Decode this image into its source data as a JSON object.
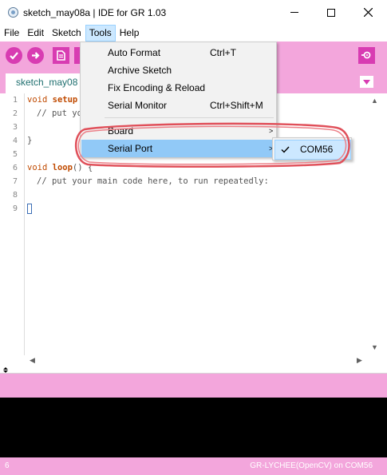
{
  "window": {
    "title": "sketch_may08a | IDE for GR 1.03",
    "icon": "app-icon"
  },
  "menubar": {
    "items": [
      {
        "label": "File"
      },
      {
        "label": "Edit"
      },
      {
        "label": "Sketch"
      },
      {
        "label": "Tools",
        "active": true
      },
      {
        "label": "Help"
      }
    ]
  },
  "toolbar": {
    "buttons": [
      "verify-icon",
      "upload-icon",
      "new-icon",
      "serial-monitor-icon"
    ]
  },
  "tab": {
    "label": "sketch_may08",
    "menu_icon": "tab-menu-icon"
  },
  "editor": {
    "line_numbers": [
      "1",
      "2",
      "3",
      "4",
      "5",
      "6",
      "7",
      "8",
      "9"
    ],
    "line1": {
      "type": "void",
      "fn": "setup"
    },
    "line2": {
      "comment": "// put yo"
    },
    "line4": {
      "text": "}"
    },
    "line6": {
      "type": "void",
      "fn": "loop",
      "rest": "() {"
    },
    "line7": {
      "comment": "// put your main code here, to run repeatedly:"
    }
  },
  "tools_menu": {
    "items": [
      {
        "label": "Auto Format",
        "shortcut": "Ctrl+T"
      },
      {
        "label": "Archive Sketch",
        "shortcut": ""
      },
      {
        "label": "Fix Encoding & Reload",
        "shortcut": ""
      },
      {
        "label": "Serial Monitor",
        "shortcut": "Ctrl+Shift+M"
      },
      {
        "label": "Board",
        "submenu": true
      },
      {
        "label": "Serial Port",
        "submenu": true,
        "highlighted": true
      }
    ]
  },
  "serial_port_submenu": {
    "items": [
      {
        "label": "COM56",
        "checked": true
      }
    ]
  },
  "status": {
    "line": "6",
    "board": "GR-LYCHEE(OpenCV) on COM56"
  },
  "colors": {
    "accent_pink": "#f3a6dc",
    "button_magenta": "#d83cb2",
    "menu_highlight": "#91c9f7",
    "annotation_red": "#e0505a"
  }
}
